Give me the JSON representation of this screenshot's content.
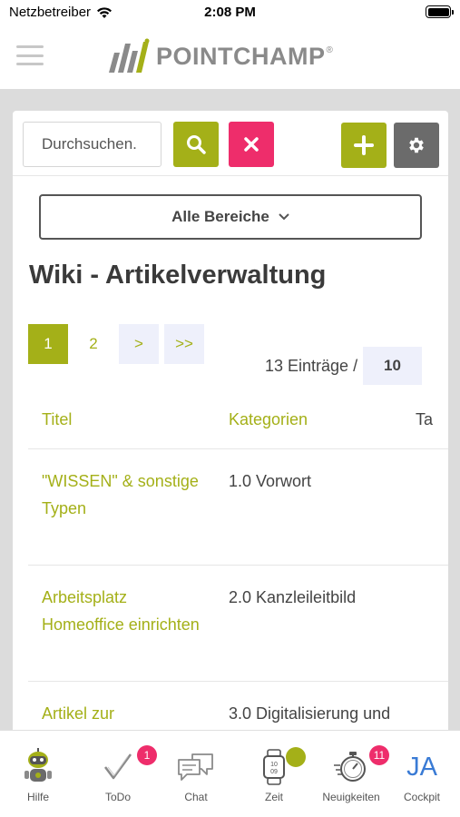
{
  "status_bar": {
    "carrier": "Netzbetreiber",
    "time": "2:08 PM"
  },
  "header": {
    "logo_text": "POINTCHAMP",
    "logo_reg": "®"
  },
  "toolbar": {
    "search_placeholder": "Durchsuchen."
  },
  "filter": {
    "selected": "Alle Bereiche"
  },
  "page": {
    "title": "Wiki - Artikelverwaltung"
  },
  "pager": {
    "pages": [
      "1",
      "2"
    ],
    "next": ">",
    "last": ">>",
    "entries_text": "13 Einträge /",
    "page_size": "10"
  },
  "table": {
    "columns": [
      "Titel",
      "Kategorien",
      "Ta"
    ],
    "rows": [
      {
        "title": "\"WISSEN\" & sonstige Typen",
        "category": "1.0 Vorwort"
      },
      {
        "title": "Arbeitsplatz Homeoffice einrichten",
        "category": "2.0 Kanzleileitbild"
      },
      {
        "title": "Artikel zur Digitalisierung und",
        "category": "3.0 Digitalisierung und"
      }
    ]
  },
  "tabs": [
    {
      "label": "Hilfe"
    },
    {
      "label": "ToDo",
      "badge": "1"
    },
    {
      "label": "Chat"
    },
    {
      "label": "Zeit"
    },
    {
      "label": "Neuigkeiten",
      "badge": "11"
    },
    {
      "label": "Cockpit",
      "avatar_initials": "JA"
    }
  ],
  "colors": {
    "accent": "#a4b018",
    "danger": "#ee2d6b",
    "neutral": "#6b6b6b",
    "avatar": "#3a7bd5"
  }
}
